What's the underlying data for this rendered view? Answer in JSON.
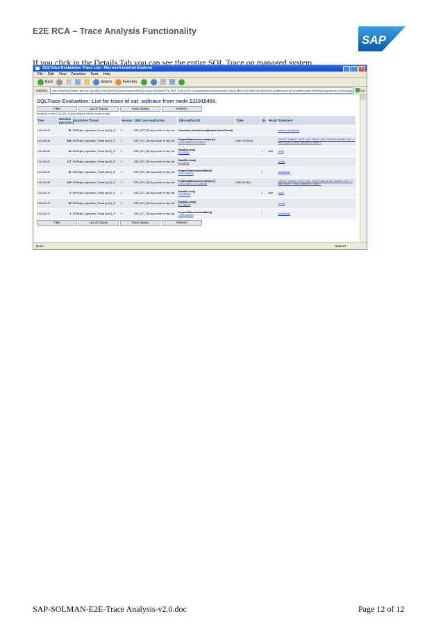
{
  "doc": {
    "header": "E2E RCA – Trace Analysis Functionality",
    "intro": "If you click in the Details Tab you can see the  entire SQL Trace on managed system.",
    "footer_left": "SAP-SOLMAN-E2E-Trace Analysis-v2.0.doc",
    "footer_right": "Page 12 of 12",
    "logo_text": "SAP"
  },
  "browser": {
    "title": "SQLTrace Evaluation: Trace List - Microsoft Internet Explorer",
    "menu": [
      "File",
      "Edit",
      "View",
      "Favorites",
      "Tools",
      "Help"
    ],
    "toolbar": {
      "back": "Back",
      "search": "Search",
      "favorites": "Favorites"
    },
    "address_label": "Address",
    "address": "http://amperd0108den.ss.rf.sit.org.net:51100/OpenSQLMonitors/servlet/SQLTraceCtrlServlet?FILTER_EVALUATE=EvaluateAction&transaction=000429B9CF653383F4E49B4BD11&addthread=allThreadRecords=99999&langunitime=100000&gtsb",
    "go": "Go",
    "status": "Done",
    "zone": "Internet"
  },
  "page": {
    "title": "SQLTrace Evaluation: List for trace id sat_sqltrace from node 211915450.",
    "buttons": [
      "Filter",
      "List of Traces",
      "Trace Status",
      "Refresh"
    ],
    "running": "Running on node 21191450. Output limited to 99999 records in total.",
    "columns": [
      "Time",
      "Duration [microsec]",
      "Dispatcher Thread",
      "Session",
      "J2EE user Application",
      "Jdbc method Id",
      "Table",
      "No.",
      "Result",
      "Statement"
    ],
    "rows": [
      {
        "time": "14:14:56.422",
        "duration": "51",
        "thread": "SAPEngine_Application_Thread [impl:3]_27",
        "session": "0",
        "user": "J2EE_GST_DMJ sap.com/tc~sl~dsp~ode",
        "method": "Connection.setAutoCommit(boolean bAutoCommit)",
        "id": "",
        "table": "",
        "no": "",
        "result": "",
        "statement": "setAutoCommit(false)"
      },
      {
        "time": "14:14:56.456",
        "duration": "669",
        "thread": "SAPEngine_Application_Thread [impl:3]_27",
        "session": "0",
        "user": "J2EE_GST_DMJ sap.com/tc~sl~dsp~ode",
        "method": "PreparedStatement.executeQuery()",
        "id": "STMT-1046830, RS-232001",
        "table": "[UME_STRINGS]",
        "no": "",
        "result": "",
        "statement": "SELECT \"VAMEIR\",\"ATTR\",\"VAL\" FROM \"UME_STRINGS\" WHERE \"PID\" = ? AND \"RIDN\" = ? AND \"VAMEIR\" = ? AND ..."
      },
      {
        "time": "14:14:56.462",
        "duration": "42",
        "thread": "SAPEngine_Application_Thread [impl:3]_27",
        "session": "0",
        "user": "J2EE_GST_DMJ sap.com/tc~sl~dsp~ode",
        "method": "ResultSet.next()",
        "id": "RS-232001",
        "table": "",
        "no": "1",
        "result": "false",
        "statement": "next()"
      },
      {
        "time": "14:14:56.467",
        "duration": "117",
        "thread": "SAPEngine_Application_Thread [impl:3]_27",
        "session": "0",
        "user": "J2EE_GST_DMJ sap.com/tc~sl~dsp~ode",
        "method": "ResultSet.close()",
        "id": "RS-232001",
        "table": "",
        "no": "",
        "result": "",
        "statement": "close()"
      },
      {
        "time": "14:14:56.467",
        "duration": "32",
        "thread": "SAPEngine_Application_Thread [impl:3]_27",
        "session": "0",
        "user": "J2EE_GST_DMJ sap.com/tc~sl~dsp~ode",
        "method": "PreparedStatement.clearBatch()",
        "id": "STMT-2048830",
        "table": "",
        "no": "1",
        "result": "",
        "statement": "clearBatch()"
      },
      {
        "time": "14:14:56.468",
        "duration": "249",
        "thread": "SAPEngine_Application_Thread [impl:3]_27",
        "session": "0",
        "user": "J2EE_GST_DMJ sap.com/tc~sl~dsp~ode",
        "method": "PreparedStatement.executeQuery()",
        "id": "STMT-2046920, RS-2385095",
        "table": "[UME_BLOBS]",
        "no": "",
        "result": "",
        "statement": "SELECT \"VAMEIR\",\"ATTR\",\"VAL\" FROM \"UME_BLOBS\" WHERE \"PID\" = ? AND \"RIDN\" = ? AND \"VAMEIR\" = ? AND ..."
      },
      {
        "time": "14:14:56.470",
        "duration": "6",
        "thread": "SAPEngine_Application_Thread [impl:3]_27",
        "session": "0",
        "user": "J2EE_GST_DMJ sap.com/tc~sl~dsp~ode",
        "method": "ResultSet.next()",
        "id": "RS-2385095",
        "table": "",
        "no": "1",
        "result": "false",
        "statement": "next()"
      },
      {
        "time": "14:14:56.471",
        "duration": "65",
        "thread": "SAPEngine_Application_Thread [impl:3]_27",
        "session": "0",
        "user": "J2EE_GST_DMJ sap.com/tc~sl~dsp~ode",
        "method": "ResultSet.close()",
        "id": "RS-2385095",
        "table": "",
        "no": "",
        "result": "",
        "statement": "close()"
      },
      {
        "time": "14:14:56.471",
        "duration": "1",
        "thread": "SAPEngine_Application_Thread [impl:3]_27",
        "session": "0",
        "user": "J2EE_GST_DMJ sap.com/tc~sl~dsp~ode",
        "method": "PreparedStatement.clearBatch()",
        "id": "STMT-2046920",
        "table": "",
        "no": "1",
        "result": "",
        "statement": "clearBatch()"
      }
    ]
  },
  "colors": {
    "sap_blue": "#0a6ab6",
    "ie_titlebar": "#0a4ad0",
    "link": "#1a3ad0"
  }
}
